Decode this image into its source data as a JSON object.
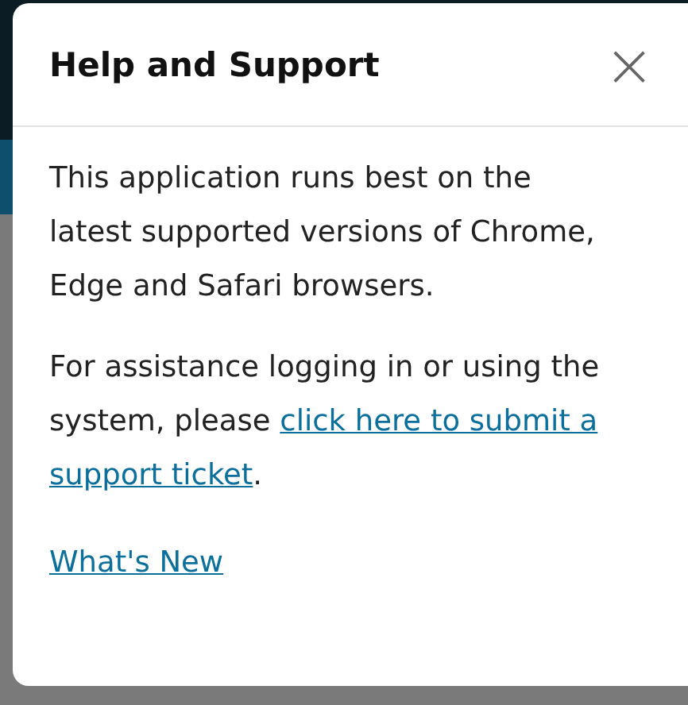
{
  "dialog": {
    "title": "Help and Support",
    "close": "×",
    "paragraphs": [
      {
        "text": "This application runs best on the latest supported versions of Chrome, Edge and Safari browsers."
      },
      {
        "text": "For assistance logging in or using the system, please ",
        "link": [
          "click here to submit a",
          "support ticket"
        ],
        "after": "."
      }
    ],
    "footer_link": "What's New"
  }
}
